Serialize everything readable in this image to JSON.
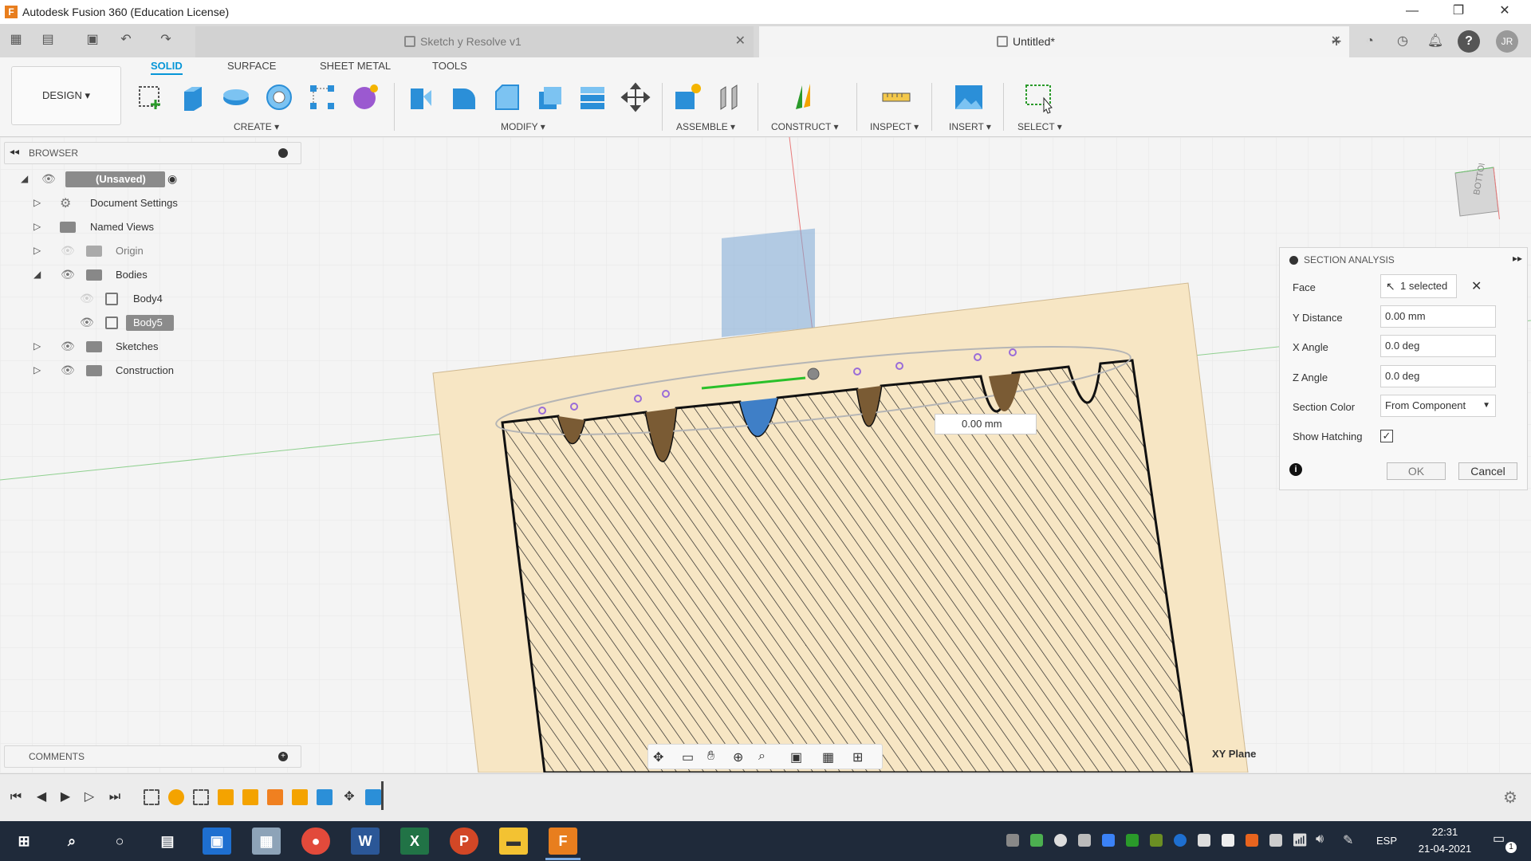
{
  "window": {
    "title": "Autodesk Fusion 360 (Education License)",
    "app_icon_letter": "F",
    "minimize": "—",
    "maximize": "❐",
    "close": "✕"
  },
  "tabs": [
    {
      "label": "Sketch y Resolve v1",
      "active": false
    },
    {
      "label": "Untitled*",
      "active": true
    }
  ],
  "tab_close": "✕",
  "right_icons": {
    "add": "+",
    "user_initials": "JR",
    "help": "?"
  },
  "ribbon": {
    "workspace_button": "DESIGN ▾",
    "tabs": [
      "SOLID",
      "SURFACE",
      "SHEET METAL",
      "TOOLS"
    ],
    "active_tab": "SOLID",
    "groups": [
      "CREATE ▾",
      "MODIFY ▾",
      "ASSEMBLE ▾",
      "CONSTRUCT ▾",
      "INSPECT ▾",
      "INSERT ▾",
      "SELECT ▾"
    ]
  },
  "browser": {
    "header": "BROWSER",
    "items": [
      {
        "label": "(Unsaved)",
        "type": "root",
        "highlight": true
      },
      {
        "label": "Document Settings",
        "type": "settings"
      },
      {
        "label": "Named Views",
        "type": "folder"
      },
      {
        "label": "Origin",
        "type": "folder",
        "dimmed": true
      },
      {
        "label": "Bodies",
        "type": "folder",
        "expanded": true
      },
      {
        "label": "Body4",
        "type": "body",
        "hidden": true
      },
      {
        "label": "Body5",
        "type": "body",
        "selected": true
      },
      {
        "label": "Sketches",
        "type": "folder"
      },
      {
        "label": "Construction",
        "type": "folder"
      }
    ]
  },
  "comments": {
    "header": "COMMENTS"
  },
  "viewcube": {
    "face": "BOTTOM"
  },
  "section_analysis": {
    "title": "SECTION ANALYSIS",
    "face_label": "Face",
    "face_value": "1 selected",
    "y_distance_label": "Y Distance",
    "y_distance_value": "0.00 mm",
    "x_angle_label": "X Angle",
    "x_angle_value": "0.0 deg",
    "z_angle_label": "Z Angle",
    "z_angle_value": "0.0 deg",
    "section_color_label": "Section Color",
    "section_color_value": "From Component",
    "show_hatching_label": "Show Hatching",
    "show_hatching_checked": true,
    "ok_label": "OK",
    "cancel_label": "Cancel"
  },
  "viewport": {
    "distance_input": "0.00 mm",
    "plane_label": "XY Plane"
  },
  "taskbar": {
    "lang": "ESP",
    "time": "22:31",
    "date": "21-04-2021",
    "notification_count": "1"
  },
  "colors": {
    "accent": "#0696d7",
    "part_fill": "#f7e6c4",
    "taskbar": "#1f2a3a"
  }
}
